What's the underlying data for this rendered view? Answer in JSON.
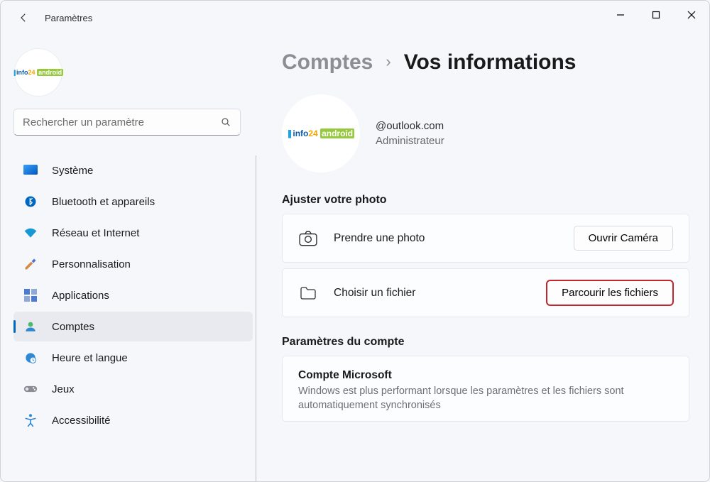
{
  "window": {
    "title": "Paramètres"
  },
  "search": {
    "placeholder": "Rechercher un paramètre"
  },
  "sidebar": {
    "items": [
      {
        "id": "system",
        "label": "Système"
      },
      {
        "id": "bluetooth",
        "label": "Bluetooth et appareils"
      },
      {
        "id": "network",
        "label": "Réseau et Internet"
      },
      {
        "id": "personalization",
        "label": "Personnalisation"
      },
      {
        "id": "apps",
        "label": "Applications"
      },
      {
        "id": "accounts",
        "label": "Comptes"
      },
      {
        "id": "time",
        "label": "Heure et langue"
      },
      {
        "id": "gaming",
        "label": "Jeux"
      },
      {
        "id": "accessibility",
        "label": "Accessibilité"
      }
    ],
    "active": "accounts"
  },
  "breadcrumb": {
    "parent": "Comptes",
    "sep": "›",
    "current": "Vos informations"
  },
  "profile": {
    "email": "@outlook.com",
    "role": "Administrateur"
  },
  "sections": {
    "adjust_photo": "Ajuster votre photo",
    "take_photo_label": "Prendre une photo",
    "open_camera_btn": "Ouvrir Caméra",
    "choose_file_label": "Choisir un fichier",
    "browse_btn": "Parcourir les fichiers",
    "account_settings": "Paramètres du compte",
    "ms_account_title": "Compte Microsoft",
    "ms_account_desc": "Windows est plus performant lorsque les paramètres et les fichiers sont automatiquement synchronisés"
  }
}
